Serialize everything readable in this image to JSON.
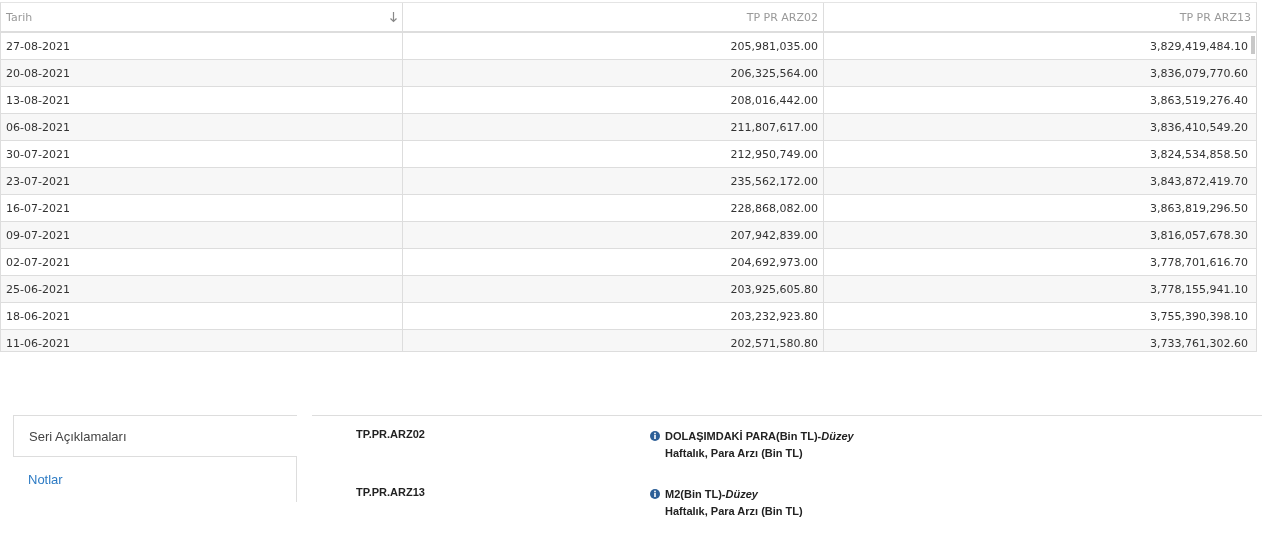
{
  "table": {
    "columns": [
      {
        "label": "Tarih",
        "sorted": true
      },
      {
        "label": "TP PR ARZ02",
        "sorted": false
      },
      {
        "label": "TP PR ARZ13",
        "sorted": false
      }
    ],
    "rows": [
      [
        "27-08-2021",
        "205,981,035.00",
        "3,829,419,484.10"
      ],
      [
        "20-08-2021",
        "206,325,564.00",
        "3,836,079,770.60"
      ],
      [
        "13-08-2021",
        "208,016,442.00",
        "3,863,519,276.40"
      ],
      [
        "06-08-2021",
        "211,807,617.00",
        "3,836,410,549.20"
      ],
      [
        "30-07-2021",
        "212,950,749.00",
        "3,824,534,858.50"
      ],
      [
        "23-07-2021",
        "235,562,172.00",
        "3,843,872,419.70"
      ],
      [
        "16-07-2021",
        "228,868,082.00",
        "3,863,819,296.50"
      ],
      [
        "09-07-2021",
        "207,942,839.00",
        "3,816,057,678.30"
      ],
      [
        "02-07-2021",
        "204,692,973.00",
        "3,778,701,616.70"
      ],
      [
        "25-06-2021",
        "203,925,605.80",
        "3,778,155,941.10"
      ],
      [
        "18-06-2021",
        "203,232,923.80",
        "3,755,390,398.10"
      ],
      [
        "11-06-2021",
        "202,571,580.80",
        "3,733,761,302.60"
      ]
    ]
  },
  "tabs": [
    {
      "label": "Seri Açıklamaları",
      "selected": true
    },
    {
      "label": "Notlar",
      "selected": false
    }
  ],
  "series": [
    {
      "code": "TP.PR.ARZ02",
      "title": "DOLAŞIMDAKİ PARA(Bin TL)-*Düzey*",
      "detail": "Haftalık, Para Arzı (Bin TL)"
    },
    {
      "code": "TP.PR.ARZ13",
      "title": "M2(Bin TL)-*Düzey*",
      "detail": "Haftalık, Para Arzı (Bin TL)"
    }
  ]
}
